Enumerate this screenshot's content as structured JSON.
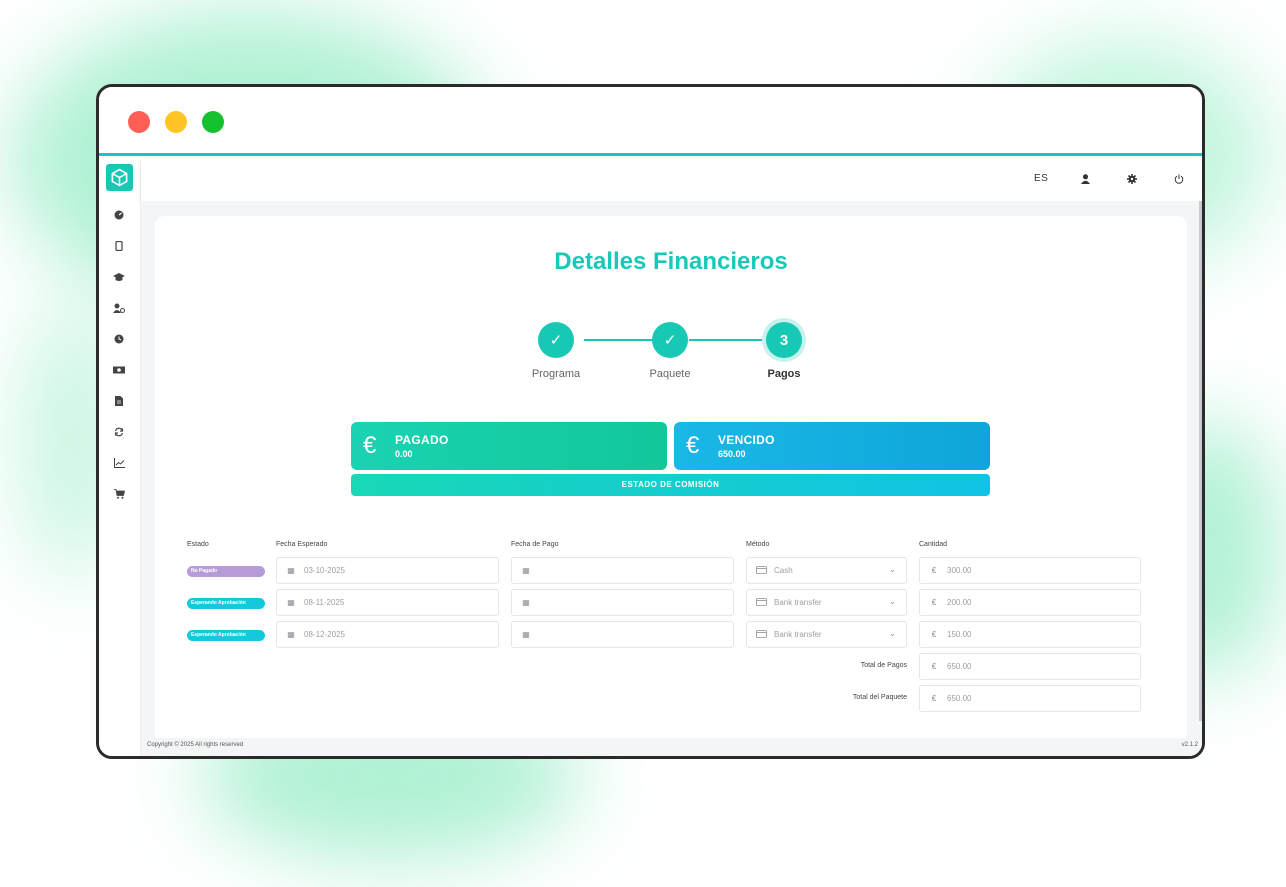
{
  "colors": {
    "accent": "#17c9b4",
    "paid": "#19d3b2",
    "due": "#1ab8e6",
    "badge_unpaid": "#b79ad8",
    "badge_pending": "#16c8dc"
  },
  "topbar": {
    "language": "ES",
    "icons": [
      "user-icon",
      "gear-icon",
      "power-icon"
    ]
  },
  "sidebar": {
    "icons": [
      "dashboard-icon",
      "phone-icon",
      "graduation-cap-icon",
      "user-settings-icon",
      "clock-icon",
      "money-icon",
      "document-icon",
      "refresh-icon",
      "chart-icon",
      "cart-icon"
    ]
  },
  "page": {
    "title": "Detalles Financieros"
  },
  "steps": [
    {
      "marker": "✓",
      "label": "Programa"
    },
    {
      "marker": "✓",
      "label": "Paquete"
    },
    {
      "marker": "3",
      "label": "Pagos"
    }
  ],
  "summary": {
    "paid": {
      "currency": "€",
      "label": "PAGADO",
      "value": "0.00"
    },
    "due": {
      "currency": "€",
      "label": "VENCIDO",
      "value": "650.00"
    },
    "commission_label": "ESTADO DE COMISIÓN"
  },
  "table": {
    "headers": [
      "Estado",
      "Fecha Esperado",
      "Fecha de Pago",
      "Método",
      "Cantidad"
    ],
    "rows": [
      {
        "status": "No Pagado",
        "expected": "03-10-2025",
        "paid_date": "",
        "method": "Cash",
        "amount": "300.00"
      },
      {
        "status": "Esperando Aprobación",
        "expected": "08-11-2025",
        "paid_date": "",
        "method": "Bank transfer",
        "amount": "200.00"
      },
      {
        "status": "Esperando Aprobación",
        "expected": "08-12-2025",
        "paid_date": "",
        "method": "Bank transfer",
        "amount": "150.00"
      }
    ],
    "totals": [
      {
        "label": "Total de Pagos",
        "value": "650.00"
      },
      {
        "label": "Total del Paquete",
        "value": "650.00"
      }
    ],
    "currency_symbol": "€"
  },
  "footer": {
    "copyright": "Copyright © 2025 All rights reserved",
    "version": "v2.1.2"
  }
}
